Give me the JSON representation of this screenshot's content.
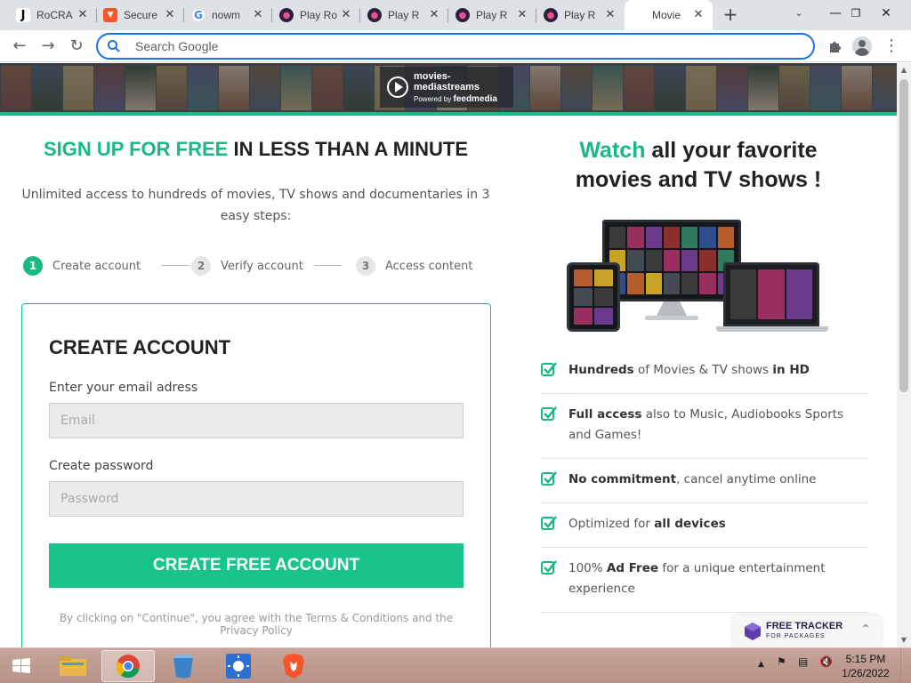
{
  "browser": {
    "tabs": [
      {
        "title": "RoCRA",
        "favicon": "J",
        "favicon_bg": "#ffffff",
        "favicon_fg": "#000000"
      },
      {
        "title": "Secure",
        "favicon": "brave-icon",
        "favicon_bg": "#fb542b",
        "favicon_fg": "#ffffff"
      },
      {
        "title": "nowm",
        "favicon": "google-icon",
        "favicon_bg": "#ffffff",
        "favicon_fg": "#4285f4"
      },
      {
        "title": "Play Ro",
        "favicon": "play-icon",
        "favicon_bg": "#e8508c",
        "favicon_fg": "#ffffff"
      },
      {
        "title": "Play R",
        "favicon": "play-icon",
        "favicon_bg": "#e8508c",
        "favicon_fg": "#ffffff"
      },
      {
        "title": "Play R",
        "favicon": "play-icon",
        "favicon_bg": "#e8508c",
        "favicon_fg": "#ffffff"
      },
      {
        "title": "Play R",
        "favicon": "play-icon",
        "favicon_bg": "#e8508c",
        "favicon_fg": "#ffffff"
      },
      {
        "title": "Movie",
        "favicon": "",
        "favicon_bg": "#ffffff",
        "favicon_fg": "#000000",
        "active": true
      }
    ],
    "address_placeholder": "Search Google",
    "address_value": ""
  },
  "banner": {
    "site_name": "movies-mediastreams",
    "powered_prefix": "Powered by",
    "powered_brand": "feedmedia"
  },
  "signup": {
    "headline_green": "SIGN UP FOR FREE",
    "headline_dark": " IN LESS THAN A MINUTE",
    "subline": "Unlimited access to hundreds of movies, TV shows and documentaries in 3 easy steps:",
    "steps": [
      {
        "num": "1",
        "label": "Create account"
      },
      {
        "num": "2",
        "label": "Verify account"
      },
      {
        "num": "3",
        "label": "Access content"
      }
    ],
    "form_title": "CREATE ACCOUNT",
    "email_label": "Enter your email adress",
    "email_placeholder": "Email",
    "password_label": "Create password",
    "password_placeholder": "Password",
    "cta": "CREATE FREE ACCOUNT",
    "terms": "By clicking on \"Continue\", you agree with the Terms & Conditions and the Privacy Policy"
  },
  "promo": {
    "title_green": "Watch",
    "title_dark": " all your favorite movies and TV shows !",
    "features": [
      {
        "parts": [
          {
            "text": "Hundreds",
            "bold": true
          },
          {
            "text": " of Movies & TV shows ",
            "bold": false
          },
          {
            "text": "in HD",
            "bold": true
          }
        ]
      },
      {
        "parts": [
          {
            "text": "Full access",
            "bold": true
          },
          {
            "text": " also to Music, Audiobooks Sports and Games!",
            "bold": false
          }
        ]
      },
      {
        "parts": [
          {
            "text": "No commitment",
            "bold": true
          },
          {
            "text": ", cancel anytime online",
            "bold": false
          }
        ]
      },
      {
        "parts": [
          {
            "text": "Optimized for ",
            "bold": false
          },
          {
            "text": "all devices",
            "bold": true
          }
        ]
      },
      {
        "parts": [
          {
            "text": "100% ",
            "bold": false
          },
          {
            "text": "Ad Free",
            "bold": true
          },
          {
            "text": " for a unique entertainment experience",
            "bold": false
          }
        ]
      }
    ]
  },
  "tracker_widget": {
    "line1": "FREE TRACKER",
    "line2": "FOR PACKAGES"
  },
  "taskbar": {
    "apps": [
      "file-explorer-icon",
      "chrome-icon",
      "recycle-bin-icon",
      "weather-icon",
      "brave-icon"
    ],
    "time": "5:15 PM",
    "date": "1/26/2022"
  },
  "colors": {
    "accent": "#19b980",
    "button": "#19c48a",
    "omnibox_focus": "#1a73e8"
  }
}
